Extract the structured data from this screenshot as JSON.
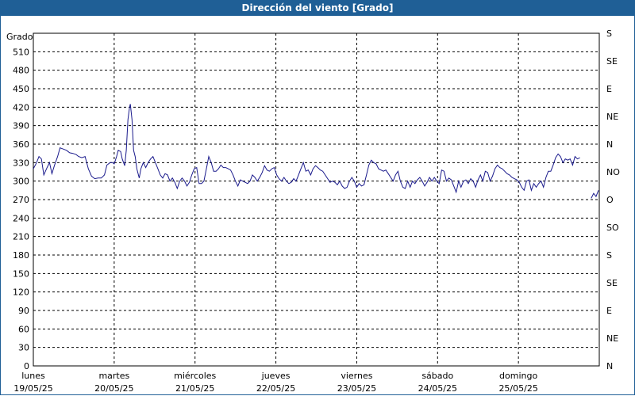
{
  "window": {
    "title": "Dirección del viento [Grado]"
  },
  "colors": {
    "title_bar": "#1f5f96",
    "series": "#1a1a8c",
    "grid": "#000000"
  },
  "chart_data": {
    "type": "line",
    "title": "Dirección del viento [Grado]",
    "ylabel": "Grado",
    "ylim": [
      0,
      540
    ],
    "yticks": [
      0,
      30,
      60,
      90,
      120,
      150,
      180,
      210,
      240,
      270,
      300,
      330,
      360,
      390,
      420,
      450,
      480,
      510
    ],
    "y2ticks": [
      {
        "value": 0,
        "label": "N"
      },
      {
        "value": 45,
        "label": "NE"
      },
      {
        "value": 90,
        "label": "E"
      },
      {
        "value": 135,
        "label": "SE"
      },
      {
        "value": 180,
        "label": "S"
      },
      {
        "value": 225,
        "label": "SO"
      },
      {
        "value": 270,
        "label": "O"
      },
      {
        "value": 315,
        "label": "NO"
      },
      {
        "value": 360,
        "label": "N"
      },
      {
        "value": 405,
        "label": "NE"
      },
      {
        "value": 450,
        "label": "E"
      },
      {
        "value": 495,
        "label": "SE"
      },
      {
        "value": 540,
        "label": "S"
      }
    ],
    "xlim": [
      0,
      7
    ],
    "xticks": [
      {
        "value": 0,
        "day": "lunes",
        "date": "19/05/25"
      },
      {
        "value": 1,
        "day": "martes",
        "date": "20/05/25"
      },
      {
        "value": 2,
        "day": "miércoles",
        "date": "21/05/25"
      },
      {
        "value": 3,
        "day": "jueves",
        "date": "22/05/25"
      },
      {
        "value": 4,
        "day": "viernes",
        "date": "23/05/25"
      },
      {
        "value": 5,
        "day": "sábado",
        "date": "24/05/25"
      },
      {
        "value": 6,
        "day": "domingo",
        "date": "25/05/25"
      },
      {
        "value": 7,
        "day": "",
        "date": ""
      }
    ],
    "grid": true,
    "series": [
      {
        "values": [
          [
            0.0,
            320
          ],
          [
            0.04,
            330
          ],
          [
            0.07,
            340
          ],
          [
            0.1,
            336
          ],
          [
            0.13,
            310
          ],
          [
            0.17,
            322
          ],
          [
            0.2,
            330
          ],
          [
            0.23,
            312
          ],
          [
            0.26,
            325
          ],
          [
            0.3,
            340
          ],
          [
            0.33,
            354
          ],
          [
            0.37,
            352
          ],
          [
            0.41,
            350
          ],
          [
            0.45,
            346
          ],
          [
            0.49,
            345
          ],
          [
            0.53,
            343
          ],
          [
            0.56,
            340
          ],
          [
            0.6,
            338
          ],
          [
            0.64,
            340
          ],
          [
            0.68,
            320
          ],
          [
            0.72,
            308
          ],
          [
            0.76,
            304
          ],
          [
            0.8,
            305
          ],
          [
            0.84,
            305
          ],
          [
            0.88,
            310
          ],
          [
            0.91,
            326
          ],
          [
            0.95,
            330
          ],
          [
            0.98,
            330
          ],
          [
            1.0,
            328
          ],
          [
            1.03,
            340
          ],
          [
            1.05,
            350
          ],
          [
            1.08,
            348
          ],
          [
            1.1,
            336
          ],
          [
            1.13,
            325
          ],
          [
            1.15,
            350
          ],
          [
            1.17,
            400
          ],
          [
            1.19,
            420
          ],
          [
            1.2,
            425
          ],
          [
            1.22,
            400
          ],
          [
            1.24,
            350
          ],
          [
            1.26,
            340
          ],
          [
            1.28,
            320
          ],
          [
            1.31,
            305
          ],
          [
            1.33,
            320
          ],
          [
            1.36,
            330
          ],
          [
            1.39,
            322
          ],
          [
            1.42,
            330
          ],
          [
            1.45,
            336
          ],
          [
            1.48,
            340
          ],
          [
            1.51,
            330
          ],
          [
            1.54,
            320
          ],
          [
            1.57,
            310
          ],
          [
            1.6,
            305
          ],
          [
            1.63,
            312
          ],
          [
            1.66,
            310
          ],
          [
            1.69,
            300
          ],
          [
            1.72,
            305
          ],
          [
            1.75,
            298
          ],
          [
            1.78,
            288
          ],
          [
            1.81,
            300
          ],
          [
            1.84,
            305
          ],
          [
            1.87,
            300
          ],
          [
            1.9,
            292
          ],
          [
            1.93,
            298
          ],
          [
            1.96,
            310
          ],
          [
            1.99,
            320
          ],
          [
            2.02,
            322
          ],
          [
            2.05,
            296
          ],
          [
            2.08,
            296
          ],
          [
            2.11,
            300
          ],
          [
            2.14,
            320
          ],
          [
            2.17,
            340
          ],
          [
            2.2,
            330
          ],
          [
            2.23,
            316
          ],
          [
            2.26,
            316
          ],
          [
            2.29,
            320
          ],
          [
            2.32,
            326
          ],
          [
            2.35,
            322
          ],
          [
            2.38,
            322
          ],
          [
            2.41,
            320
          ],
          [
            2.44,
            318
          ],
          [
            2.47,
            310
          ],
          [
            2.5,
            300
          ],
          [
            2.53,
            292
          ],
          [
            2.56,
            302
          ],
          [
            2.59,
            300
          ],
          [
            2.62,
            298
          ],
          [
            2.65,
            296
          ],
          [
            2.68,
            300
          ],
          [
            2.71,
            310
          ],
          [
            2.74,
            306
          ],
          [
            2.77,
            300
          ],
          [
            2.8,
            306
          ],
          [
            2.83,
            314
          ],
          [
            2.86,
            325
          ],
          [
            2.89,
            318
          ],
          [
            2.92,
            316
          ],
          [
            2.95,
            320
          ],
          [
            2.98,
            322
          ],
          [
            3.01,
            310
          ],
          [
            3.04,
            304
          ],
          [
            3.07,
            300
          ],
          [
            3.1,
            306
          ],
          [
            3.13,
            300
          ],
          [
            3.16,
            296
          ],
          [
            3.19,
            298
          ],
          [
            3.22,
            304
          ],
          [
            3.25,
            300
          ],
          [
            3.28,
            310
          ],
          [
            3.31,
            320
          ],
          [
            3.34,
            330
          ],
          [
            3.37,
            316
          ],
          [
            3.4,
            318
          ],
          [
            3.43,
            310
          ],
          [
            3.46,
            320
          ],
          [
            3.49,
            325
          ],
          [
            3.52,
            322
          ],
          [
            3.55,
            318
          ],
          [
            3.58,
            316
          ],
          [
            3.61,
            310
          ],
          [
            3.64,
            304
          ],
          [
            3.67,
            298
          ],
          [
            3.7,
            300
          ],
          [
            3.73,
            298
          ],
          [
            3.76,
            294
          ],
          [
            3.79,
            300
          ],
          [
            3.82,
            292
          ],
          [
            3.85,
            288
          ],
          [
            3.88,
            290
          ],
          [
            3.91,
            300
          ],
          [
            3.94,
            306
          ],
          [
            3.97,
            300
          ],
          [
            4.0,
            290
          ],
          [
            4.03,
            296
          ],
          [
            4.06,
            292
          ],
          [
            4.09,
            294
          ],
          [
            4.12,
            310
          ],
          [
            4.15,
            326
          ],
          [
            4.18,
            334
          ],
          [
            4.21,
            330
          ],
          [
            4.24,
            328
          ],
          [
            4.27,
            320
          ],
          [
            4.3,
            318
          ],
          [
            4.33,
            316
          ],
          [
            4.36,
            318
          ],
          [
            4.39,
            312
          ],
          [
            4.42,
            306
          ],
          [
            4.45,
            300
          ],
          [
            4.48,
            310
          ],
          [
            4.51,
            316
          ],
          [
            4.54,
            300
          ],
          [
            4.57,
            290
          ],
          [
            4.6,
            288
          ],
          [
            4.63,
            300
          ],
          [
            4.66,
            290
          ],
          [
            4.69,
            300
          ],
          [
            4.72,
            296
          ],
          [
            4.75,
            302
          ],
          [
            4.78,
            306
          ],
          [
            4.81,
            300
          ],
          [
            4.84,
            292
          ],
          [
            4.87,
            298
          ],
          [
            4.9,
            306
          ],
          [
            4.93,
            300
          ],
          [
            4.96,
            306
          ],
          [
            4.99,
            300
          ],
          [
            5.02,
            296
          ],
          [
            5.05,
            318
          ],
          [
            5.08,
            316
          ],
          [
            5.11,
            300
          ],
          [
            5.14,
            305
          ],
          [
            5.17,
            302
          ],
          [
            5.2,
            292
          ],
          [
            5.23,
            282
          ],
          [
            5.26,
            300
          ],
          [
            5.29,
            290
          ],
          [
            5.32,
            300
          ],
          [
            5.35,
            302
          ],
          [
            5.38,
            296
          ],
          [
            5.41,
            304
          ],
          [
            5.44,
            300
          ],
          [
            5.47,
            290
          ],
          [
            5.5,
            302
          ],
          [
            5.53,
            310
          ],
          [
            5.56,
            300
          ],
          [
            5.59,
            316
          ],
          [
            5.62,
            314
          ],
          [
            5.65,
            300
          ],
          [
            5.68,
            308
          ],
          [
            5.71,
            320
          ],
          [
            5.74,
            326
          ],
          [
            5.77,
            322
          ],
          [
            5.8,
            320
          ],
          [
            5.83,
            316
          ],
          [
            5.86,
            312
          ],
          [
            5.89,
            310
          ],
          [
            5.92,
            306
          ],
          [
            5.95,
            304
          ],
          [
            5.98,
            302
          ],
          [
            6.01,
            298
          ],
          [
            6.04,
            290
          ],
          [
            6.07,
            285
          ],
          [
            6.1,
            300
          ],
          [
            6.13,
            302
          ],
          [
            6.16,
            285
          ],
          [
            6.19,
            296
          ],
          [
            6.22,
            290
          ],
          [
            6.25,
            296
          ],
          [
            6.28,
            300
          ],
          [
            6.31,
            290
          ],
          [
            6.34,
            306
          ],
          [
            6.37,
            316
          ],
          [
            6.4,
            316
          ],
          [
            6.43,
            326
          ],
          [
            6.46,
            338
          ],
          [
            6.49,
            344
          ],
          [
            6.52,
            340
          ],
          [
            6.55,
            330
          ],
          [
            6.58,
            336
          ],
          [
            6.61,
            334
          ],
          [
            6.64,
            336
          ],
          [
            6.67,
            326
          ],
          [
            6.7,
            340
          ],
          [
            6.73,
            336
          ],
          [
            6.76,
            338
          ]
        ]
      },
      {
        "values": [
          [
            6.9,
            272
          ],
          [
            6.93,
            280
          ],
          [
            6.96,
            275
          ],
          [
            6.99,
            285
          ]
        ]
      }
    ]
  }
}
